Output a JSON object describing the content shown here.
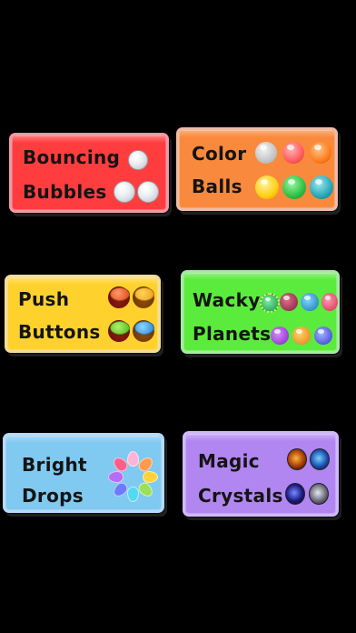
{
  "cards": [
    {
      "line1": "Bouncing",
      "line2": "Bubbles",
      "color": "#ff3b3b"
    },
    {
      "line1": "Color",
      "line2": "Balls",
      "color": "#f9873b"
    },
    {
      "line1": "Push",
      "line2": "Buttons",
      "color": "#ffd02a"
    },
    {
      "line1": "Wacky",
      "line2": "Planets",
      "color": "#58ea3b"
    },
    {
      "line1": "Bright",
      "line2": "Drops",
      "color": "#7fc9f0"
    },
    {
      "line1": "Magic",
      "line2": "Crystals",
      "color": "#b386f2"
    }
  ],
  "colors": {
    "background": "#000000",
    "ball_gray": "#cfcfcf",
    "ball_red": "#ff6b6b",
    "ball_orange": "#ff8a2a",
    "ball_yellow": "#ffd21a",
    "ball_green": "#33c24a",
    "ball_teal": "#2aa9b8"
  }
}
